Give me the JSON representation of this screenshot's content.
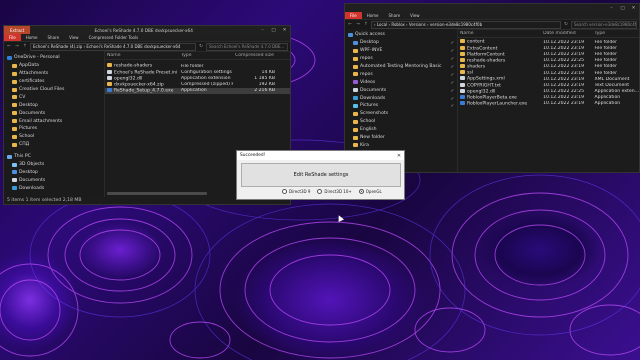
{
  "left_window": {
    "context_tab": "Extract",
    "title": "Echoei's ReShade 4.7.0 DBE dxvkpsuecker-x64",
    "ribbon": [
      "File",
      "Home",
      "Share",
      "View",
      "Compressed Folder Tools"
    ],
    "path": "Echoei's ReShade (4).zip  ›  Echoei's ReShade 4.7.0 DBE dxvkpsuecker-x64",
    "search_placeholder": "Search Echoei's ReShade 4.7.0 DBE...",
    "nav_items": [
      {
        "label": "OneDrive - Personal",
        "color": "#2f7fd8"
      },
      {
        "label": "AppData",
        "color": "#e8b64a"
      },
      {
        "label": "Attachments",
        "color": "#e8b64a"
      },
      {
        "label": "certificates",
        "color": "#e8b64a"
      },
      {
        "label": "Creative Cloud Files",
        "color": "#e8b64a"
      },
      {
        "label": "CV",
        "color": "#e8b64a"
      },
      {
        "label": "Desktop",
        "color": "#e8b64a"
      },
      {
        "label": "Documents",
        "color": "#e8b64a"
      },
      {
        "label": "Email attachments",
        "color": "#e8b64a"
      },
      {
        "label": "Pictures",
        "color": "#e8b64a"
      },
      {
        "label": "School",
        "color": "#e8b64a"
      },
      {
        "label": "СПД",
        "color": "#e8b64a"
      },
      {
        "label": "",
        "color": "transparent"
      },
      {
        "label": "This PC",
        "color": "#6aa9e8"
      },
      {
        "label": "3D Objects",
        "color": "#7ec1f0"
      },
      {
        "label": "Desktop",
        "color": "#4f8fe0"
      },
      {
        "label": "Documents",
        "color": "#cfd6e0"
      },
      {
        "label": "Downloads",
        "color": "#3a9ad8"
      }
    ],
    "columns": [
      "Name",
      "Type",
      "Compressed size"
    ],
    "files": [
      {
        "name": "reshade-shaders",
        "type": "File folder",
        "size": "",
        "icon": "folder"
      },
      {
        "name": "Echoei's ReShade Preset.ini",
        "type": "Configuration settings",
        "size": "14 KB",
        "icon": "file"
      },
      {
        "name": "opengl32.dll",
        "type": "Application extension",
        "size": "1 185 KB",
        "icon": "file"
      },
      {
        "name": "dxvkpsuecker-x64.zip",
        "type": "Compressed (zipped) Fol...",
        "size": "192 KB",
        "icon": "folder"
      },
      {
        "name": "ReShade_Setup_4.7.0.exe",
        "type": "Application",
        "size": "2 216 KB",
        "icon": "app",
        "selected": true
      }
    ],
    "status": "5 items    1 item selected  2,18 MB"
  },
  "right_window": {
    "ribbon": [
      "File",
      "Home",
      "Share",
      "View"
    ],
    "path": "›  Local  ›  Roblox  ›  Versions  ›  version-e3de8c1980c4f0b",
    "search_placeholder": "Search version-e3de8c1980c4f0b",
    "nav_items": [
      {
        "label": "Quick access",
        "color": "#4a90e0"
      },
      {
        "label": "Desktop",
        "color": "#4f8fe0"
      },
      {
        "label": "WPF-INVE",
        "color": "#e8b64a"
      },
      {
        "label": "repos",
        "color": "#e8b64a"
      },
      {
        "label": "Automated Testing Mentoring Basic",
        "color": "#e8b64a"
      },
      {
        "label": "repos",
        "color": "#e8b64a"
      },
      {
        "label": "Videos",
        "color": "#9a5ad8"
      },
      {
        "label": "Documents",
        "color": "#cfd6e0"
      },
      {
        "label": "Downloads",
        "color": "#3a9ad8"
      },
      {
        "label": "Pictures",
        "color": "#5ac0e8"
      },
      {
        "label": "Screenshots",
        "color": "#e8b64a"
      },
      {
        "label": "School",
        "color": "#e8b64a"
      },
      {
        "label": "English",
        "color": "#e8b64a"
      },
      {
        "label": "New folder",
        "color": "#e8b64a"
      },
      {
        "label": "Kira",
        "color": "#e8b64a"
      },
      {
        "label": "Тексты",
        "color": "#e8b64a"
      }
    ],
    "columns": [
      "Name",
      "Date modified",
      "Type"
    ],
    "files": [
      {
        "name": "content",
        "date": "10.12.2022 23:19",
        "type": "File folder",
        "icon": "folder"
      },
      {
        "name": "ExtraContent",
        "date": "10.12.2022 23:19",
        "type": "File folder",
        "icon": "folder"
      },
      {
        "name": "PlatformContent",
        "date": "10.12.2022 23:19",
        "type": "File folder",
        "icon": "folder"
      },
      {
        "name": "reshade-shaders",
        "date": "10.12.2022 22:25",
        "type": "File folder",
        "icon": "folder"
      },
      {
        "name": "shaders",
        "date": "10.12.2022 23:19",
        "type": "File folder",
        "icon": "folder"
      },
      {
        "name": "ssl",
        "date": "10.12.2022 23:19",
        "type": "File folder",
        "icon": "folder"
      },
      {
        "name": "AppSettings.xml",
        "date": "10.12.2022 23:19",
        "type": "XML Document",
        "icon": "file"
      },
      {
        "name": "COPYRIGHT.txt",
        "date": "10.12.2022 23:19",
        "type": "Text Document",
        "icon": "file"
      },
      {
        "name": "opengl32.dll",
        "date": "10.12.2022 22:25",
        "type": "Application exten...",
        "icon": "file"
      },
      {
        "name": "RobloxPlayerBeta.exe",
        "date": "10.12.2022 23:19",
        "type": "Application",
        "icon": "app"
      },
      {
        "name": "RobloxPlayerLauncher.exe",
        "date": "10.12.2022 23:19",
        "type": "Application",
        "icon": "app"
      }
    ]
  },
  "dialog": {
    "title": "Succeeded!",
    "button_label": "Edit ReShade settings",
    "radios": [
      {
        "label": "Direct3D 9",
        "checked": false
      },
      {
        "label": "Direct3D 10+",
        "checked": false
      },
      {
        "label": "OpenGL",
        "checked": true
      }
    ]
  }
}
